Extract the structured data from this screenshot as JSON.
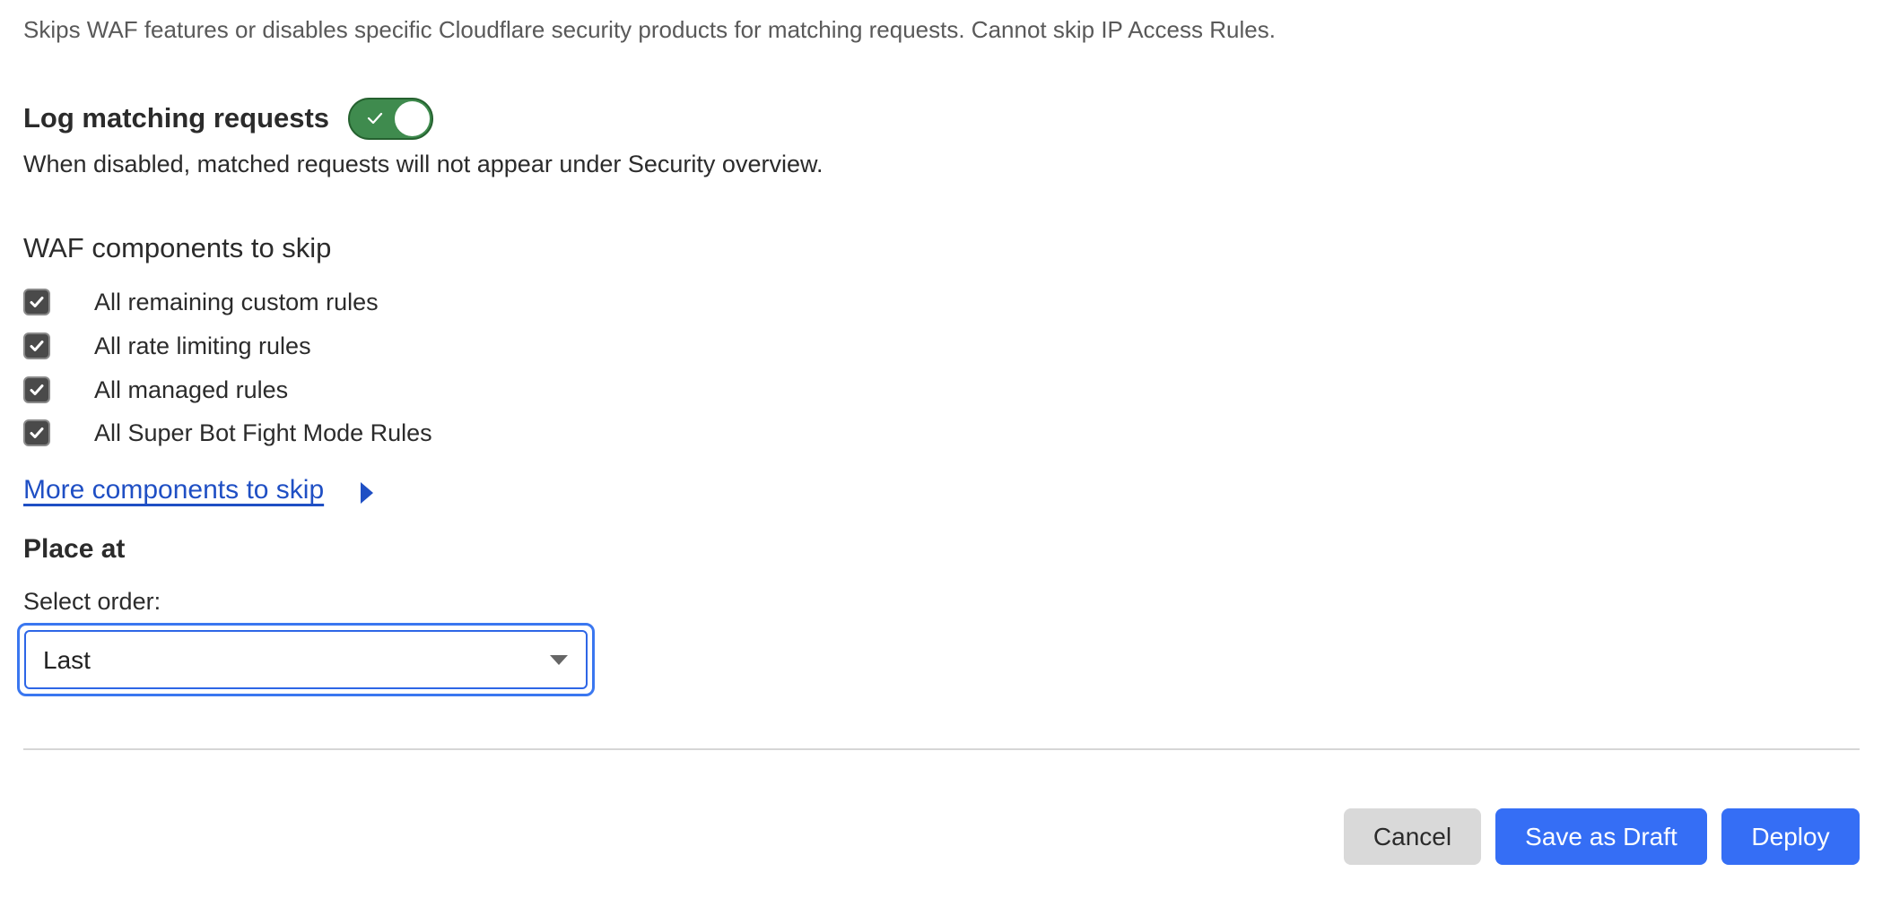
{
  "description": "Skips WAF features or disables specific Cloudflare security products for matching requests. Cannot skip IP Access Rules.",
  "log": {
    "title": "Log matching requests",
    "enabled": true,
    "help": "When disabled, matched requests will not appear under Security overview.",
    "toggle_color": "#3f8b4e"
  },
  "waf": {
    "title": "WAF components to skip",
    "items": [
      {
        "label": "All remaining custom rules",
        "checked": true
      },
      {
        "label": "All rate limiting rules",
        "checked": true
      },
      {
        "label": "All managed rules",
        "checked": true
      },
      {
        "label": "All Super Bot Fight Mode Rules",
        "checked": true
      }
    ],
    "more_link": "More components to skip"
  },
  "place": {
    "title": "Place at",
    "order_label": "Select order:",
    "order_value": "Last"
  },
  "footer": {
    "cancel": "Cancel",
    "save_draft": "Save as Draft",
    "deploy": "Deploy",
    "primary_color": "#356ef5"
  }
}
